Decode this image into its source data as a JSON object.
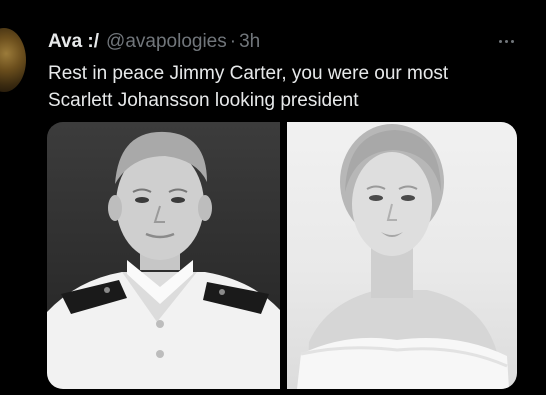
{
  "tweet": {
    "display_name": "Ava :/",
    "handle": "@avapologies",
    "separator": "·",
    "time": "3h",
    "text_lines": [
      "Rest in peace Jimmy Carter, you were our most",
      "Scarlett Johansson looking president"
    ],
    "more_icon": "more-horizontal-icon"
  },
  "media": {
    "images": [
      {
        "subject": "black-and-white portrait photo"
      },
      {
        "subject": "black-and-white portrait photo"
      }
    ]
  },
  "colors": {
    "background": "#000000",
    "text_primary": "#e7e9ea",
    "text_secondary": "#71767b"
  }
}
